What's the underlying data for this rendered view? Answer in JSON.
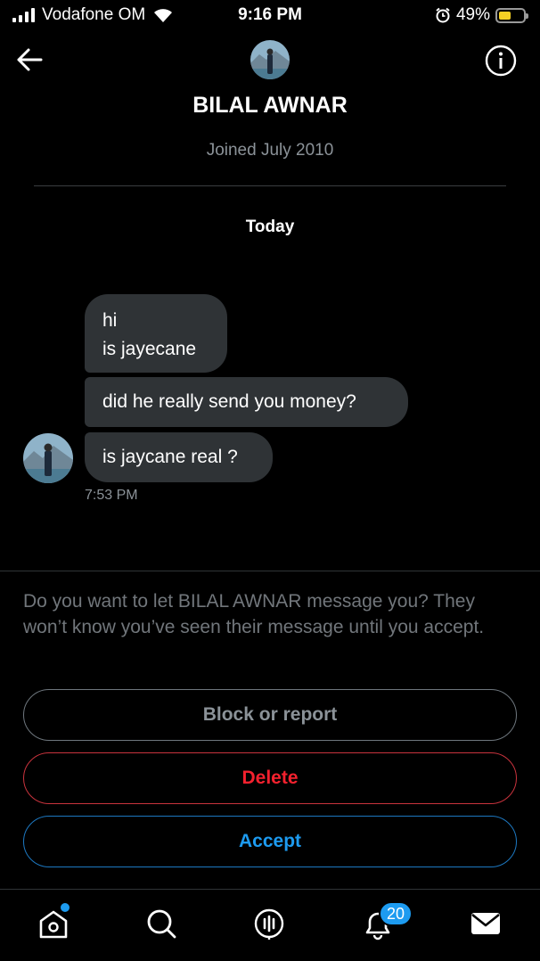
{
  "status_bar": {
    "carrier": "Vodafone OM",
    "time": "9:16 PM",
    "battery": "49%",
    "battery_level": 0.49,
    "icons": [
      "signal-icon",
      "wifi-icon",
      "alarm-icon",
      "battery-icon"
    ]
  },
  "header": {
    "name": "BILAL AWNAR",
    "joined": "Joined July 2010",
    "back_icon": "arrow-left-icon",
    "info_icon": "info-icon"
  },
  "conversation": {
    "day_label": "Today",
    "messages": [
      {
        "lines": [
          "hi",
          "is jayecane"
        ]
      },
      {
        "lines": [
          "did he really send you money?"
        ]
      },
      {
        "lines": [
          "is jaycane real ?"
        ]
      }
    ],
    "timestamp": "7:53 PM"
  },
  "request": {
    "prompt": "Do you want to let BILAL AWNAR message you? They won’t know you’ve seen their message until you accept.",
    "block_label": "Block or report",
    "delete_label": "Delete",
    "accept_label": "Accept"
  },
  "tab_bar": {
    "tabs": [
      "home-icon",
      "search-icon",
      "spaces-icon",
      "notifications-icon",
      "messages-icon"
    ],
    "notifications_count": "20"
  },
  "colors": {
    "background": "#000000",
    "bubble": "#2f3336",
    "accent": "#1d9bf0",
    "danger": "#f4212e",
    "muted": "#8b9298",
    "battery": "#f5d024"
  }
}
